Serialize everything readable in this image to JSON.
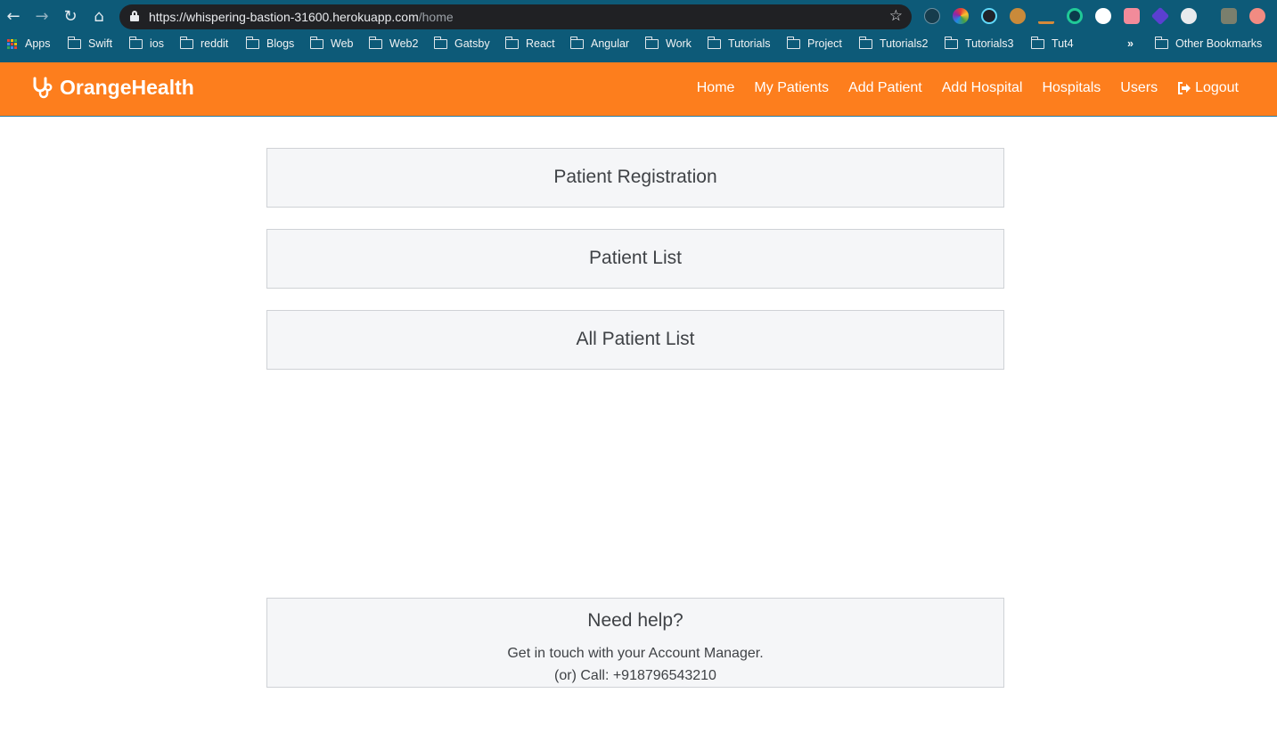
{
  "browser": {
    "url_base": "https://whispering-bastion-31600.herokuapp.com",
    "url_path": "/home",
    "bookmarks": [
      "Apps",
      "Swift",
      "ios",
      "reddit",
      "Blogs",
      "Web",
      "Web2",
      "Gatsby",
      "React",
      "Angular",
      "Work",
      "Tutorials",
      "Project",
      "Tutorials2",
      "Tutorials3",
      "Tut4"
    ],
    "overflow": "»",
    "other_bookmarks": "Other Bookmarks"
  },
  "navbar": {
    "brand": "OrangeHealth",
    "links": [
      "Home",
      "My Patients",
      "Add Patient",
      "Add Hospital",
      "Hospitals",
      "Users"
    ],
    "logout": "Logout",
    "color": "#fd7e1d"
  },
  "main": {
    "cards": [
      "Patient Registration",
      "Patient List",
      "All Patient List"
    ]
  },
  "help": {
    "title": "Need help?",
    "line1": "Get in touch with your Account Manager.",
    "line2": "(or) Call: +918796543210"
  }
}
